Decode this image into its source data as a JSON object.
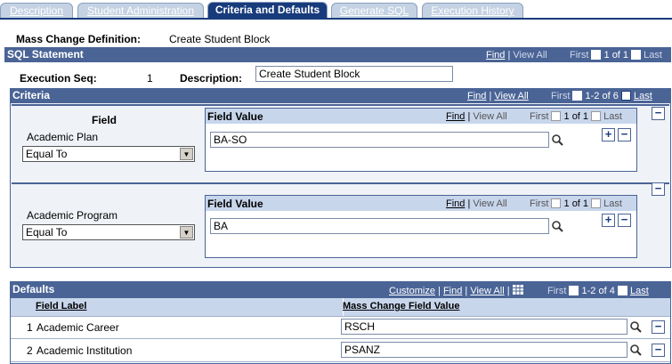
{
  "tabs": [
    {
      "label": "Description",
      "active": false
    },
    {
      "label": "Student Administration",
      "active": false
    },
    {
      "label": "Criteria and Defaults",
      "active": true
    },
    {
      "label": "Generate SQL",
      "active": false
    },
    {
      "label": "Execution History",
      "active": false
    }
  ],
  "definition": {
    "label": "Mass Change Definition:",
    "value": "Create Student Block"
  },
  "sql": {
    "title": "SQL Statement",
    "find": "Find",
    "view_all": "View All",
    "first": "First",
    "count": "1 of 1",
    "last": "Last",
    "exec_label": "Execution Seq:",
    "exec_value": "1",
    "desc_label": "Description:",
    "desc_value": "Create Student Block"
  },
  "criteria": {
    "title": "Criteria",
    "find": "Find",
    "view_all": "View All",
    "first": "First",
    "count": "1-2 of 6",
    "last": "Last",
    "field_header": "Field",
    "rows": [
      {
        "field": "Academic Plan",
        "operator": "Equal To",
        "fv_header": "Field Value",
        "find": "Find",
        "view_all": "View All",
        "first": "First",
        "count": "1 of 1",
        "last": "Last",
        "value": "BA-SO"
      },
      {
        "field": "Academic Program",
        "operator": "Equal To",
        "fv_header": "Field Value",
        "find": "Find",
        "view_all": "View All",
        "first": "First",
        "count": "1 of 1",
        "last": "Last",
        "value": "BA"
      }
    ]
  },
  "defaults": {
    "title": "Defaults",
    "customize": "Customize",
    "find": "Find",
    "view_all": "View All",
    "first": "First",
    "count": "1-2 of 4",
    "last": "Last",
    "col_label": "Field Label",
    "col_value": "Mass Change Field Value",
    "rows": [
      {
        "num": "1",
        "label": "Academic Career",
        "value": "RSCH"
      },
      {
        "num": "2",
        "label": "Academic Institution",
        "value": "PSANZ"
      }
    ]
  },
  "icons": {
    "lookup": "magnifier-icon",
    "add": "plus-icon",
    "remove": "minus-icon",
    "prev": "left-arrow-icon",
    "next": "right-arrow-icon",
    "grid": "grid-download-icon"
  }
}
